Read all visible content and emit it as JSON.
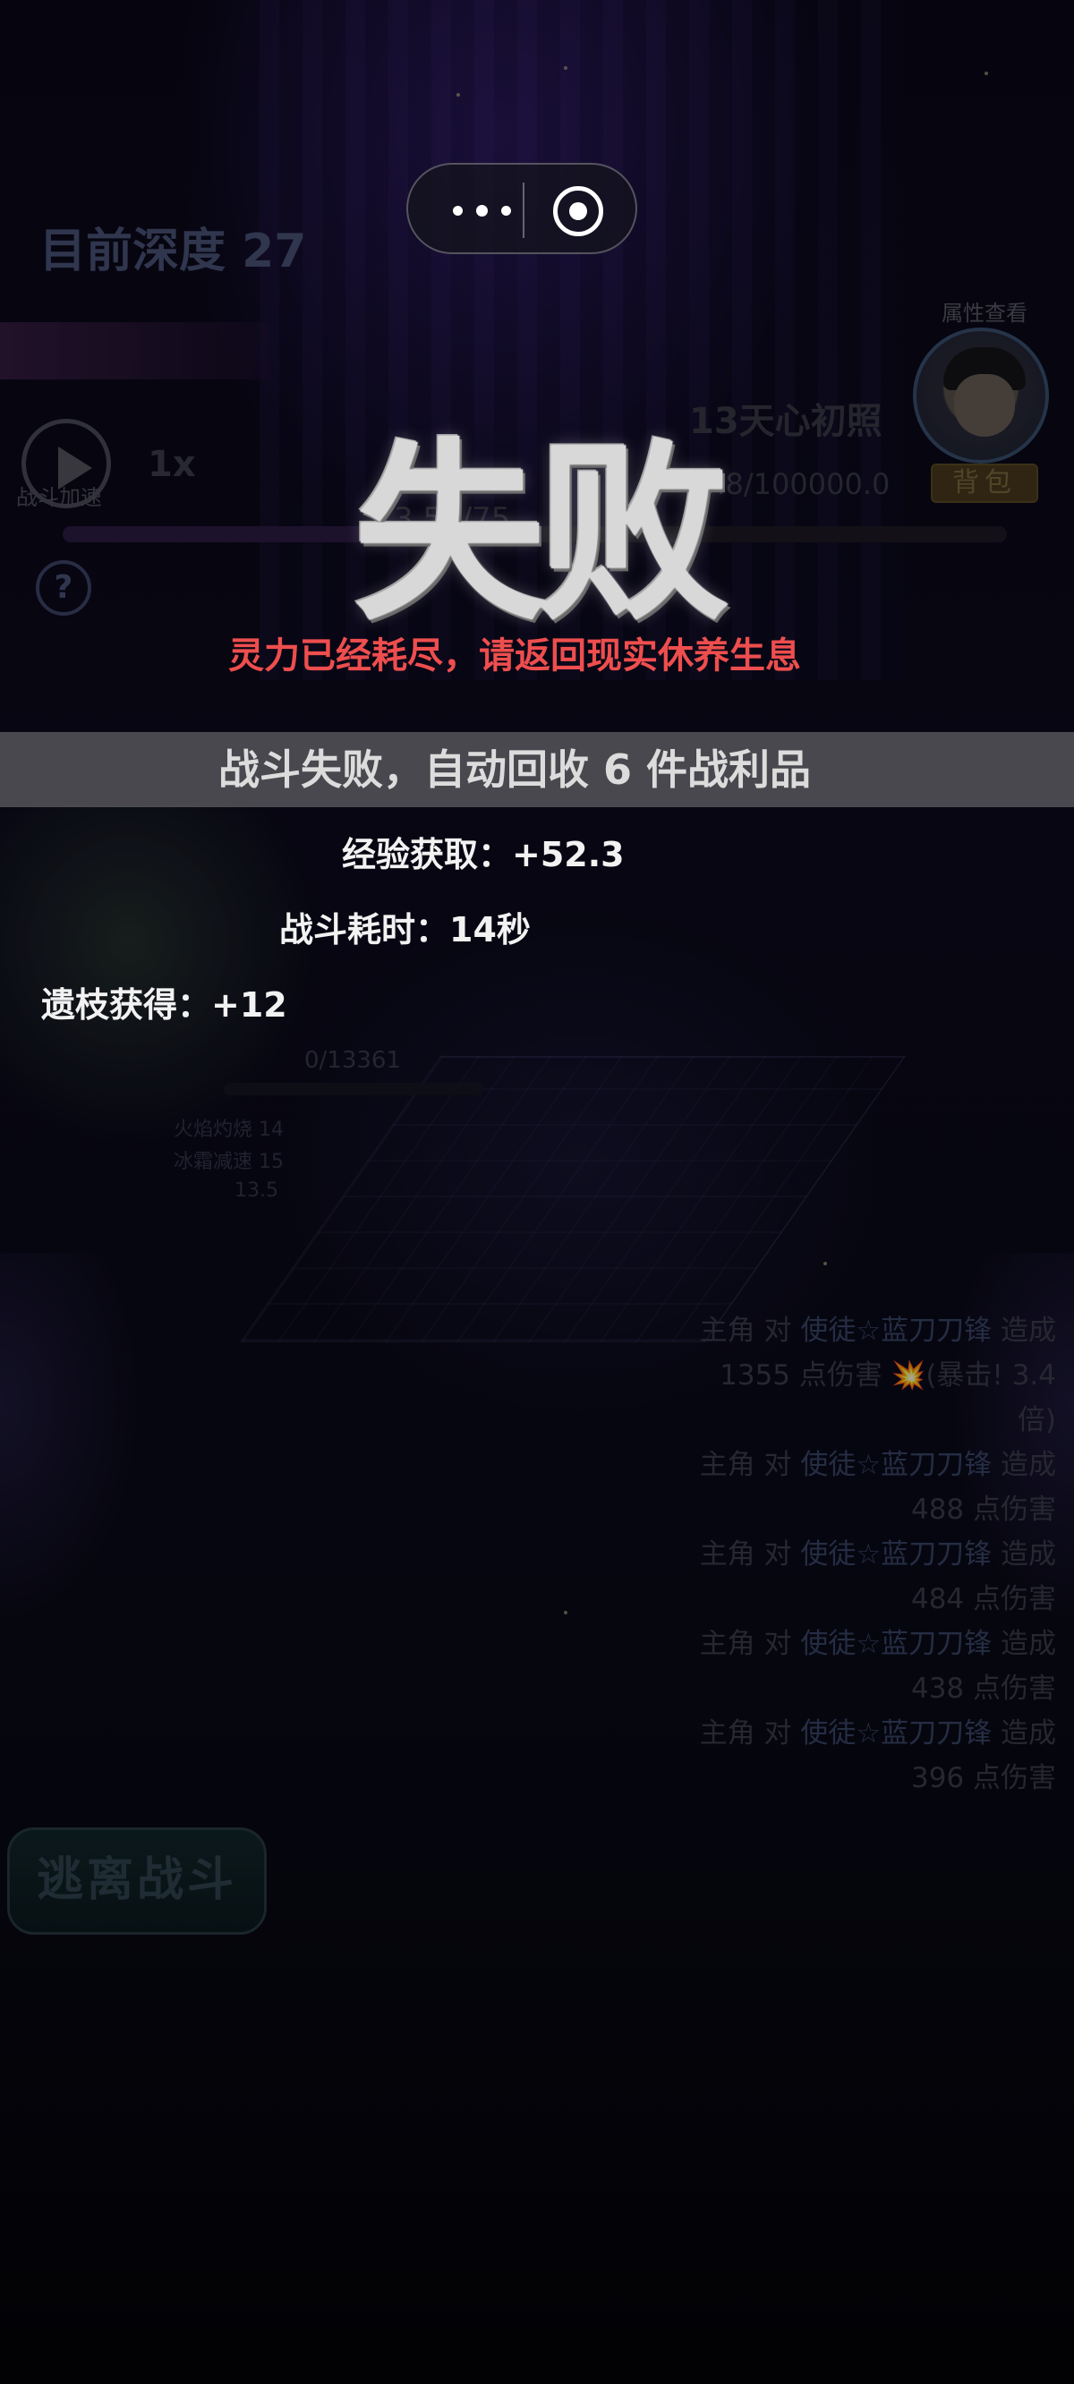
{
  "hud": {
    "depth_text": "目前深度 27",
    "speed_label": "战斗加速",
    "speed_value": "1x",
    "help_symbol": "?",
    "attr_view_label": "属性查看",
    "bag_label": "背包",
    "player_name": "13天心初照",
    "player_exp": "3.8/100000.0",
    "player_hp": "3   54/75",
    "progress_fraction": 0.35
  },
  "enemy": {
    "hp_text": "0/13361",
    "stats": [
      "火焰灼烧 14",
      "冰霜减速 15",
      "13.5"
    ]
  },
  "battle_log": [
    {
      "pre": "主角 对 ",
      "target": "使徒☆蓝刀刀锋",
      "post": " 造成 1355 点伤害 💥(暴击! 3.4倍)"
    },
    {
      "pre": "主角 对 ",
      "target": "使徒☆蓝刀刀锋",
      "post": " 造成 488 点伤害"
    },
    {
      "pre": "主角 对 ",
      "target": "使徒☆蓝刀刀锋",
      "post": " 造成 484 点伤害"
    },
    {
      "pre": "主角 对 ",
      "target": "使徒☆蓝刀刀锋",
      "post": " 造成 438 点伤害"
    },
    {
      "pre": "主角 对 ",
      "target": "使徒☆蓝刀刀锋",
      "post": " 造成 396 点伤害"
    }
  ],
  "escape_label": "逃离战斗",
  "capsule": {
    "more_icon": "more-dots-icon",
    "close_icon": "target-close-icon"
  },
  "result": {
    "title": "失败",
    "message": "灵力已经耗尽，请返回现实休养生息",
    "banner": "战斗失败，自动回收 6 件战利品",
    "exp": "经验获取：+52.3",
    "time": "战斗耗时：14秒",
    "relic": "遗枝获得：+12"
  },
  "colors": {
    "message_red": "#ee4e4e",
    "banner_gray": "#808080",
    "text_white": "#f2f2f2"
  }
}
